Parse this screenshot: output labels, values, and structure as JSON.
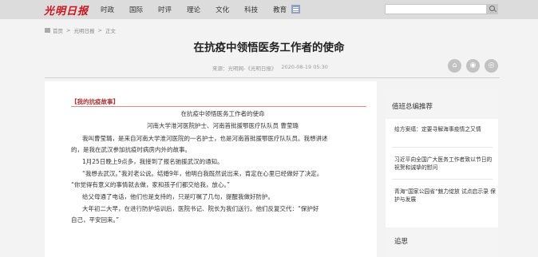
{
  "header": {
    "logo": "光明日报",
    "nav": [
      "时政",
      "国际",
      "时评",
      "理论",
      "文化",
      "科技",
      "教育"
    ],
    "search_placeholder": ""
  },
  "breadcrumb": {
    "home": "首页",
    "section": "光明日报",
    "current": "正文"
  },
  "article": {
    "title": "在抗疫中领悟医务工作者的使命",
    "source": "来源：光明网-《光明日报》",
    "date": "2020-08-19 05:30",
    "tag": "【我的抗疫故事】",
    "subtitle": "在抗疫中领悟医务工作者的使命",
    "author": "河南大学淮河医院护士、河南首批援鄂医疗队队员 曹莹璐",
    "paragraphs": [
      "我叫曹莹璐，是来自河南大学淮河医院的一名护士，也是河南首批援鄂医疗队队员。我想讲述",
      "的，是我在武汉参加抗疫时病房内外的故事。",
      "1月25日晚上9点多，我接到了报名驰援武汉的通知。",
      "“我想去武汉。”我对老公说。结婚9年，他明白我既然说出来，肯定在心里已经做好了决定。",
      "“你觉得有意义的事情就去做，家和孩子们都交给我，放心。”",
      "给父母通了电话，他们也是支持的，只是叮嘱了几句，提醒我做好防护。",
      "大年初二大早，在进行防护培训后，医院书记、院长为我们送行。他们反复交代：“保护好",
      "自己，平安回来。”"
    ]
  },
  "sidebar": {
    "heading": "值班总编推荐",
    "items": [
      "给方案缮：定要寻解海事疫情之又情",
      "习近平向全国广大医务工作者致以节日的祝贺和诚挚的慰问",
      "青海“国家公园省”魅力绽放 试点启示录 保护与发展"
    ],
    "footer": "追思"
  }
}
